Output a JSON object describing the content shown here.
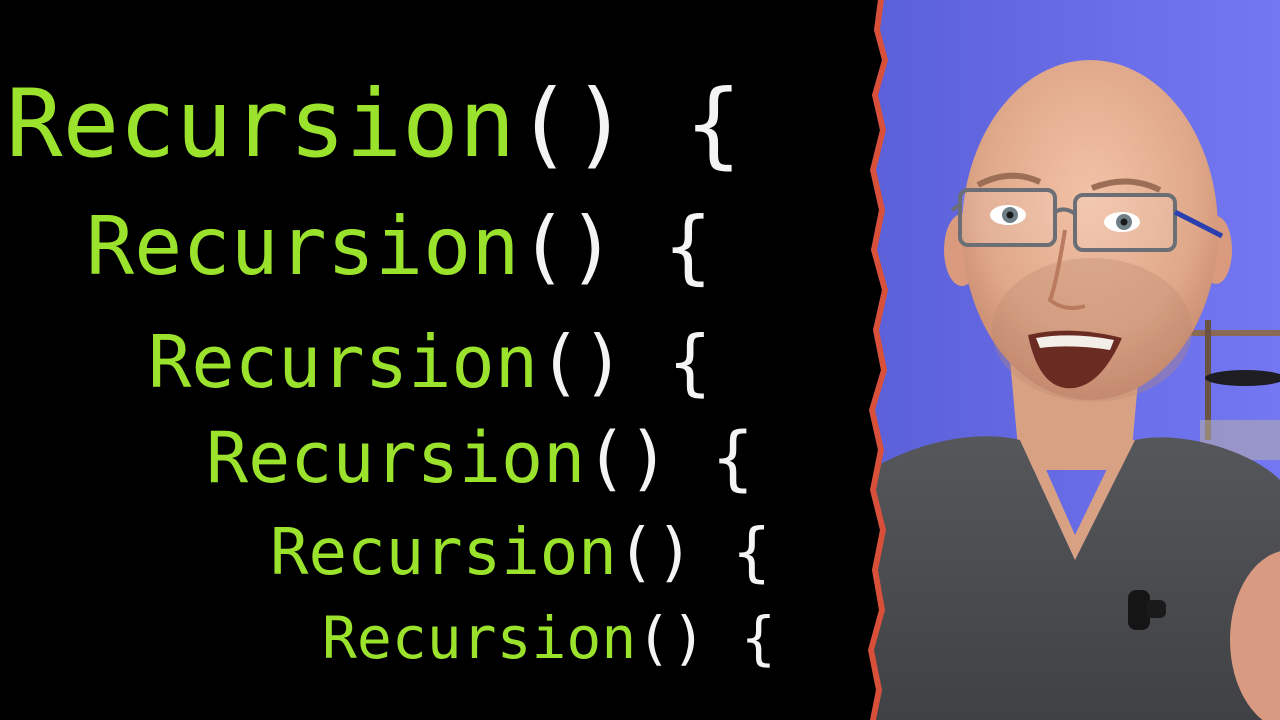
{
  "code_lines": [
    {
      "name": "Recursion",
      "parens": "()",
      "brace": "{"
    },
    {
      "name": "Recursion",
      "parens": "()",
      "brace": "{"
    },
    {
      "name": "Recursion",
      "parens": "()",
      "brace": "{"
    },
    {
      "name": "Recursion",
      "parens": "()",
      "brace": "{"
    },
    {
      "name": "Recursion",
      "parens": "()",
      "brace": "{"
    },
    {
      "name": "Recursion",
      "parens": "()",
      "brace": "{"
    }
  ],
  "colors": {
    "function_name": "#9be22d",
    "punctuation": "#f4f4f4",
    "background": "#000000",
    "torn_edge": "#d8503a",
    "backdrop": "#6b6ef0"
  }
}
